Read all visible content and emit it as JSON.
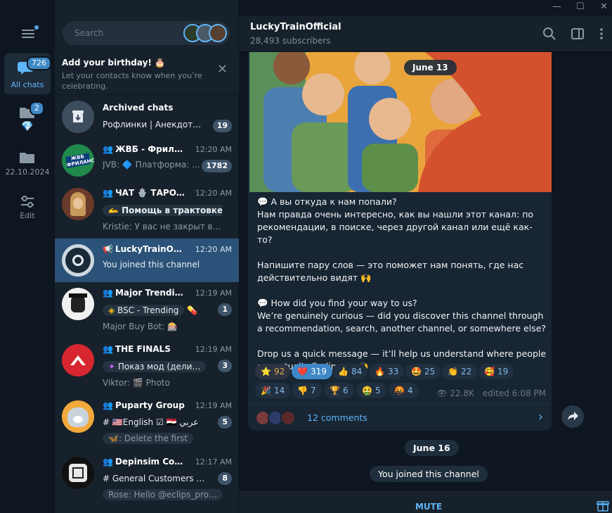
{
  "rail": {
    "items": [
      {
        "label": "All chats",
        "badge": "726"
      },
      {
        "label": "",
        "badge": "2"
      },
      {
        "label": "22.10.2024",
        "badge": ""
      },
      {
        "label": "Edit",
        "badge": ""
      }
    ]
  },
  "search": {
    "placeholder": "Search"
  },
  "birthday": {
    "title": "Add your birthday! 🎂",
    "text": "Let your contacts know when you’re celebrating."
  },
  "chats": [
    {
      "title": "Archived chats",
      "time": "",
      "line2": "Рофлинки | Анекдот…",
      "line3": "",
      "count": "19"
    },
    {
      "title": "ЖВБ - Фриланс",
      "time": "12:20 AM",
      "from": "JVB:",
      "line2": " 🔷 Платформа: …",
      "line3": "",
      "count": "1782"
    },
    {
      "title": "ЧАТ 🪬 ТАРО …",
      "time": "12:20 AM",
      "line2": "🫴 Помощь в трактовке",
      "line3": "Kristie: У вас не закрыт воп…",
      "count": ""
    },
    {
      "title": "LuckyTrainOffi…",
      "time": "12:20 AM",
      "line2": "You joined this channel",
      "line3": "",
      "count": ""
    },
    {
      "title": "Major Trendi…",
      "time": "12:19 AM",
      "line2": "BSC - Trending",
      "line3": "Major Buy Bot: 🎰",
      "count": "1"
    },
    {
      "title": "THE FINALS",
      "time": "12:19 AM",
      "line2": "Показ мод (дели…",
      "line3": "Viktor: 🎬 Photo",
      "count": "3"
    },
    {
      "title": "Puparty Group",
      "time": "12:19 AM",
      "line2": "# 🇺🇸English  ☑ 🇪🇬 عربي",
      "line3": "🦋: Delete the first",
      "count": "5"
    },
    {
      "title": "Depinsim Co…",
      "time": "12:17 AM",
      "line2": "# General   Customers …",
      "line3": "Rose: Hello @eclips_pro…",
      "count": "8"
    }
  ],
  "channel": {
    "name": "LuckyTrainOfficial",
    "subscribers": "28,493 subscribers"
  },
  "post": {
    "date": "June 13",
    "text": "💬 А вы откуда к нам попали?\nНам правда очень интересно, как вы нашли этот канал: по рекомендации, в поиске, через другой канал или ещё как-то?\n\nНапишите пару слов — это поможет нам понять, где нас действительно видят 🙌\n\n💬 How did you find your way to us?\nWe’re genuinely curious — did you discover this channel through a recommendation, search, another channel, or somewhere else?\n\nDrop us a quick message — it’ll help us understand where people are actually finding us 🙌",
    "reactions": [
      {
        "emoji": "⭐",
        "count": "92"
      },
      {
        "emoji": "❤️",
        "count": "319"
      },
      {
        "emoji": "👍",
        "count": "84"
      },
      {
        "emoji": "🔥",
        "count": "33"
      },
      {
        "emoji": "🤩",
        "count": "25"
      },
      {
        "emoji": "👏",
        "count": "22"
      },
      {
        "emoji": "🥰",
        "count": "19"
      },
      {
        "emoji": "🎉",
        "count": "14"
      },
      {
        "emoji": "👎",
        "count": "7"
      },
      {
        "emoji": "🏆",
        "count": "6"
      },
      {
        "emoji": "🤮",
        "count": "5"
      },
      {
        "emoji": "🤬",
        "count": "4"
      }
    ],
    "views": "22.8K",
    "edited": "edited 6:08 PM",
    "comments": "12 comments"
  },
  "date2": "June 16",
  "system_msg": "You joined this channel",
  "mute_label": "MUTE",
  "colors": {
    "accent": "#5eb5f7",
    "active_chat": "#2b5278",
    "selected_reaction": "#3e88c7"
  }
}
